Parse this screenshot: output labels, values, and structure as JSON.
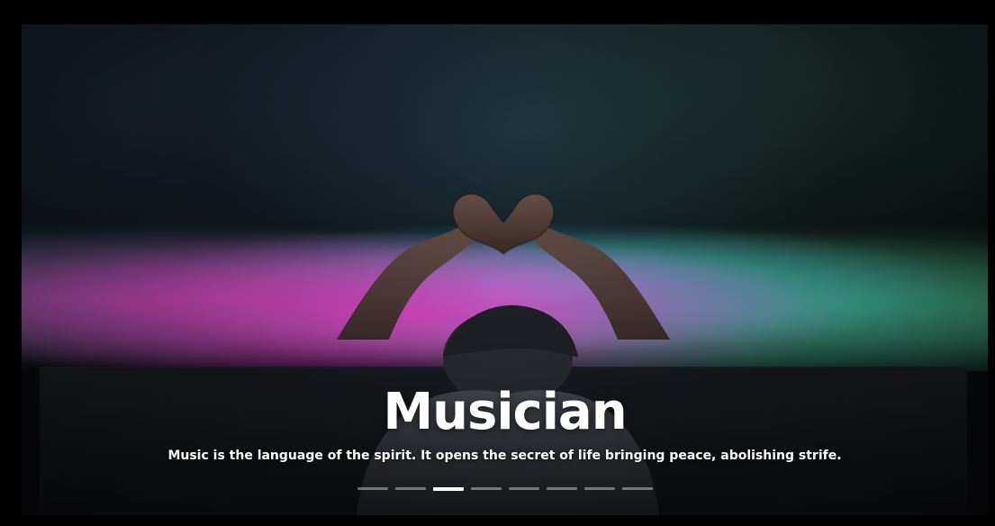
{
  "slide": {
    "title": "Musician",
    "subtitle": "Music is the language of the spirit. It opens the secret of life bringing peace, abolishing strife."
  },
  "pagination": {
    "count": 8,
    "active_index": 2
  },
  "colors": {
    "frame": "#000000",
    "text": "#ffffff",
    "pager_inactive": "rgba(255,255,255,0.40)",
    "pager_active": "#ffffff"
  },
  "icons": {
    "slide_background": "concert-photo"
  }
}
